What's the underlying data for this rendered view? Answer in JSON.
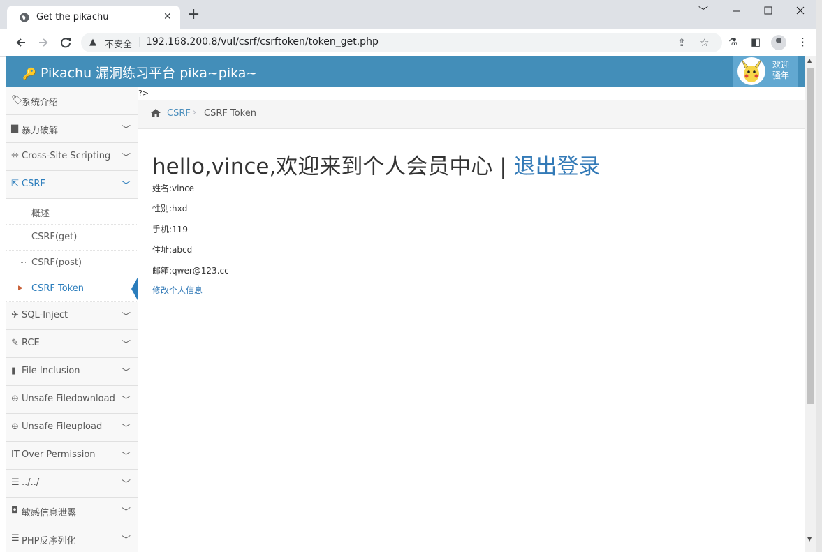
{
  "browser": {
    "tab_title": "Get the pikachu",
    "tab_close": "✕",
    "new_tab": "+",
    "minimize": "﹀",
    "address": {
      "security_label": "不安全",
      "url": "192.168.200.8/vul/csrf/csrftoken/token_get.php"
    }
  },
  "navbar": {
    "brand": "Pikachu 漏洞练习平台 pika~pika~",
    "welcome_line1": "欢迎",
    "welcome_line2": "骚年"
  },
  "sidebar": {
    "items": [
      {
        "label": "系统介绍",
        "icon": "tags-icon",
        "glyph": "🏷"
      },
      {
        "label": "暴力破解",
        "icon": "lock-icon",
        "glyph": "▆"
      },
      {
        "label": "Cross-Site Scripting",
        "icon": "indent-icon",
        "glyph": "⁜"
      },
      {
        "label": "CSRF",
        "icon": "share-icon",
        "glyph": "⇱"
      },
      {
        "label": "SQL-Inject",
        "icon": "plane-icon",
        "glyph": "✈"
      },
      {
        "label": "RCE",
        "icon": "pencil-icon",
        "glyph": "✎"
      },
      {
        "label": "File Inclusion",
        "icon": "file-icon",
        "glyph": "▮"
      },
      {
        "label": "Unsafe Filedownload",
        "icon": "download-circle-icon",
        "glyph": "⊕"
      },
      {
        "label": "Unsafe Fileupload",
        "icon": "upload-circle-icon",
        "glyph": "⊕"
      },
      {
        "label": "Over Permission",
        "icon": "text-height-icon",
        "glyph": "ⅠT"
      },
      {
        "label": "../../",
        "icon": "align-left-icon",
        "glyph": "☰"
      },
      {
        "label": "敏感信息泄露",
        "icon": "camera-icon",
        "glyph": "◘"
      },
      {
        "label": "PHP反序列化",
        "icon": "align-justify-icon",
        "glyph": "☰"
      }
    ],
    "csrf_sub": [
      "概述",
      "CSRF(get)",
      "CSRF(post)",
      "CSRF Token"
    ]
  },
  "main": {
    "stray_text": "?>",
    "breadcrumb_link": "CSRF",
    "breadcrumb_sep": "›",
    "breadcrumb_current": "CSRF Token",
    "heading_text": "hello,vince,欢迎来到个人会员中心 | ",
    "logout": "退出登录",
    "info": [
      "姓名:vince",
      "性别:hxd",
      "手机:119",
      "住址:abcd",
      "邮箱:qwer@123.cc"
    ],
    "edit_link": "修改个人信息"
  },
  "colors": {
    "navbar": "#438eb9",
    "accent": "#2b7dbc",
    "link": "#337ab7"
  }
}
